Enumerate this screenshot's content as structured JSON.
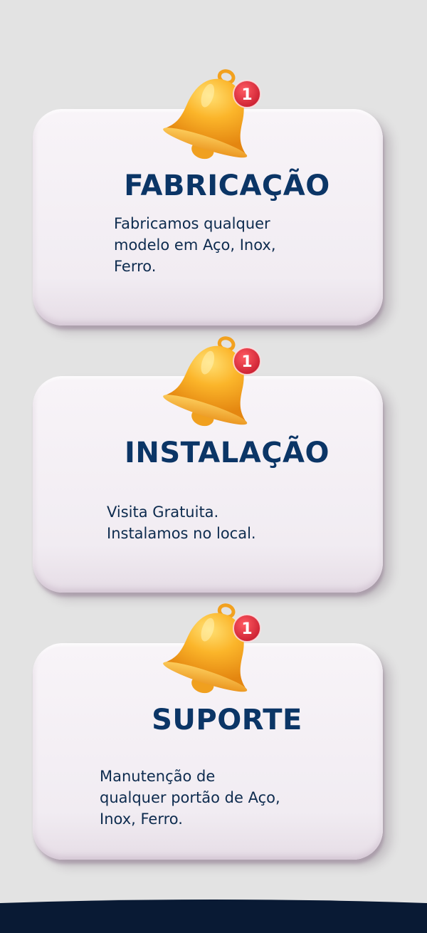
{
  "cards": [
    {
      "title": "FABRICAÇÃO",
      "description_lines": [
        "Fabricamos qualquer",
        "modelo em Aço, Inox,",
        "Ferro."
      ],
      "badge": "1"
    },
    {
      "title": "INSTALAÇÃO",
      "description_lines": [
        "Visita Gratuita.",
        "Instalamos no local."
      ],
      "badge": "1"
    },
    {
      "title": "SUPORTE",
      "description_lines": [
        "Manutenção de",
        "qualquer portão de Aço,",
        "Inox, Ferro."
      ],
      "badge": "1"
    }
  ],
  "icons": {
    "bell": "notification-bell-icon",
    "badge": "notification-badge"
  },
  "colors": {
    "background": "#e3e3e3",
    "card": "#f3eef4",
    "title": "#0b3566",
    "text": "#0d2b4e",
    "bell": "#f8ad22",
    "badge": "#dc2b3b",
    "footer": "#091a34"
  }
}
